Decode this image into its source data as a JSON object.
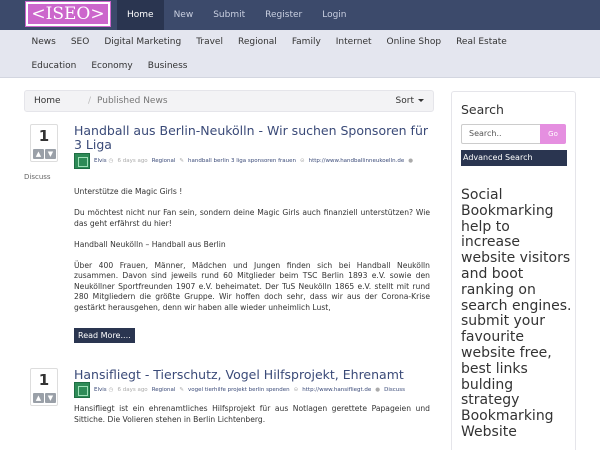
{
  "logo": {
    "text": "<ISEO>"
  },
  "topnav": [
    {
      "label": "Home",
      "active": true
    },
    {
      "label": "New"
    },
    {
      "label": "Submit"
    },
    {
      "label": "Register"
    },
    {
      "label": "Login"
    }
  ],
  "categories": {
    "row1": [
      "News",
      "SEO",
      "Digital Marketing",
      "Travel",
      "Regional",
      "Family",
      "Internet",
      "Online Shop",
      "Real Estate"
    ],
    "row2": [
      "Education",
      "Economy",
      "Business"
    ]
  },
  "breadcrumb": {
    "home": "Home",
    "sep": "/",
    "current": "Published News",
    "sort": "Sort"
  },
  "posts": [
    {
      "votes": "1",
      "discuss_label": "Discuss",
      "title": "Handball aus Berlin-Neukölln - Wir suchen Sponsoren für 3 Liga",
      "user": "Elvis",
      "time": "6 days ago",
      "category": "Regional",
      "tags": "handball berlin 3 liga sponsoren frauen",
      "link": "http://www.handballinneukoelln.de",
      "paragraphs": [
        "Unterstütze die Magic Girls !",
        "Du möchtest nicht nur Fan sein, sondern deine Magic Girls auch finanziell unterstützen? Wie das geht erfährst du hier!",
        "Handball Neukölln – Handball aus Berlin",
        "Über 400 Frauen, Männer, Mädchen und Jungen finden sich bei Handball Neukölln zusammen. Davon sind jeweils rund 60 Mitglieder beim TSC Berlin 1893 e.V. sowie den Neuköllner Sportfreunden 1907 e.V. beheimatet. Der TuS Neukölln 1865 e.V. stellt mit rund 280 Mitgliedern die größte Gruppe. Wir hoffen doch sehr, dass wir aus der Corona-Krise gestärkt herausgehen, denn wir haben alle wieder unheimlich Lust,"
      ],
      "read_more": "Read More...."
    },
    {
      "votes": "1",
      "title": "Hansifliegt - Tierschutz, Vogel Hilfsprojekt, Ehrenamt",
      "user": "Elvis",
      "time": "6 days ago",
      "category": "Regional",
      "tags": "vogel tierhilfe projekt berlin spenden",
      "link": "http://www.hansifliegt.de",
      "discuss_label": "Discuss",
      "paragraphs": [
        "Hansifliegt ist ein ehrenamtliches Hilfsprojekt für aus Notlagen gerettete Papageien und Sittiche. Die Volieren stehen in Berlin Lichtenberg."
      ]
    }
  ],
  "sidebar": {
    "title": "Search",
    "search_placeholder": "Search..",
    "go_label": "Go",
    "advanced_label": "Advanced Search",
    "blurb": "Social Bookmarking help to increase website visitors and boot ranking on search engines. submit your favourite website free, best links bulding strategy Bookmarking Website"
  },
  "colors": {
    "navbar": "#3c4a6b",
    "accent": "#cc66cc",
    "dark_button": "#2a3550",
    "link": "#3a4a78"
  }
}
